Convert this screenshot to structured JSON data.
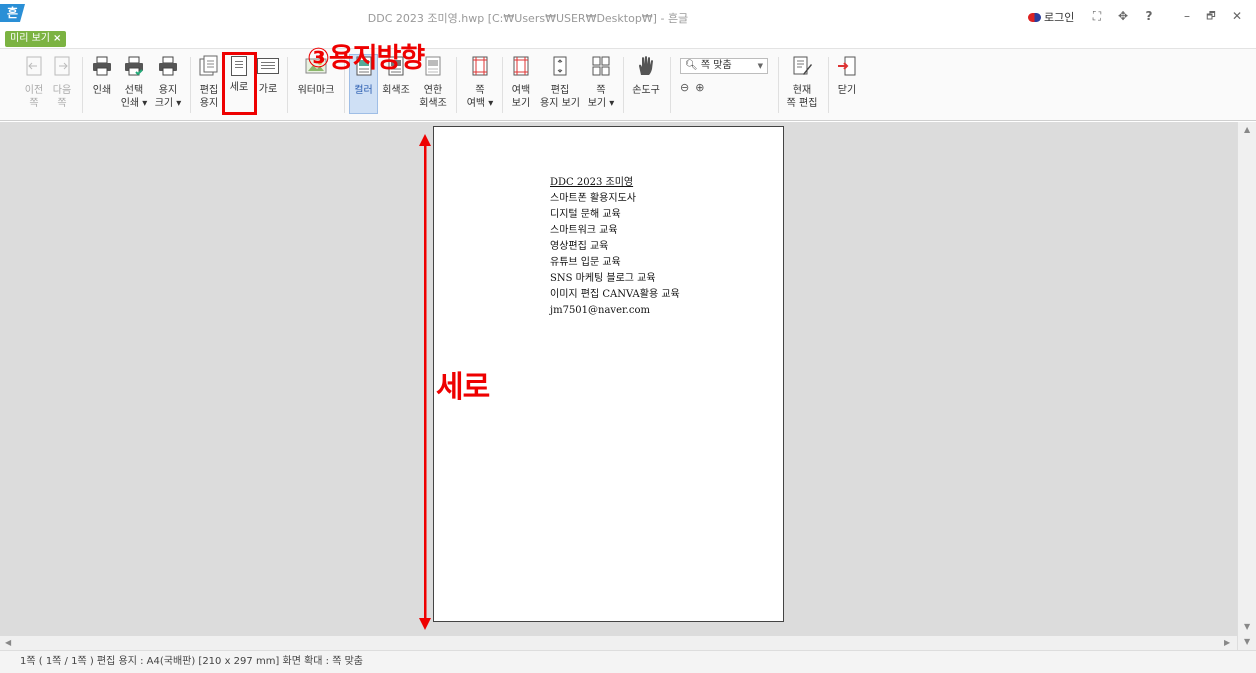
{
  "app": {
    "logo_text": "흔",
    "window_title": "DDC 2023 조미영.hwp [C:₩Users₩USER₩Desktop₩] - 흔글",
    "login_label": "로그인"
  },
  "window_controls": {
    "fullscreen": "⛶",
    "move": "✥",
    "help": "?",
    "minimize": "–",
    "restore": "🗗",
    "close": "✕"
  },
  "tab": {
    "label": "미리 보기",
    "close": "×"
  },
  "toolbar": {
    "prev": [
      "이전",
      "쪽"
    ],
    "next": [
      "다음",
      "쪽"
    ],
    "print": "인쇄",
    "select_print": [
      "선택",
      "인쇄 ▾"
    ],
    "paper_size": [
      "용지",
      "크기 ▾"
    ],
    "edit_paper": [
      "편집",
      "용지"
    ],
    "portrait": "세로",
    "landscape": "가로",
    "watermark": "워터마크",
    "color": "컬러",
    "grayscale": "회색조",
    "light_gray": [
      "연한",
      "회색조"
    ],
    "page_margin": [
      "쪽",
      "여백 ▾"
    ],
    "margin_view": [
      "여백",
      "보기"
    ],
    "edit_paper_view": [
      "편집",
      "용지 보기"
    ],
    "page_view": [
      "쪽",
      "보기 ▾"
    ],
    "hand_tool": "손도구",
    "zoom_select": "쪽 맞춤",
    "current_page_edit": [
      "현재",
      "쪽 편집"
    ],
    "close": "닫기"
  },
  "annotation": {
    "callout": "③용지방향",
    "orientation_label": "세로"
  },
  "document": {
    "lines": [
      "DDC 2023 조미영",
      "스마트폰 활용지도사",
      "디지털 문해 교육",
      "스마트워크 교육",
      "영상편집 교육",
      "유튜브 입문 교육",
      "SNS 마케팅 블로그 교육",
      "이미지 편집 CANVA활용 교육",
      "jm7501@naver.com"
    ]
  },
  "statusbar": {
    "text": "1쪽 ( 1쪽 / 1쪽 ) 편집 용지 : A4(국배판) [210 x 297 mm] 화면 확대 : 쪽 맞춤"
  },
  "colors": {
    "accent_green": "#7cb342",
    "annotation_red": "#e00000",
    "active_tool": "#cfe0f5"
  }
}
